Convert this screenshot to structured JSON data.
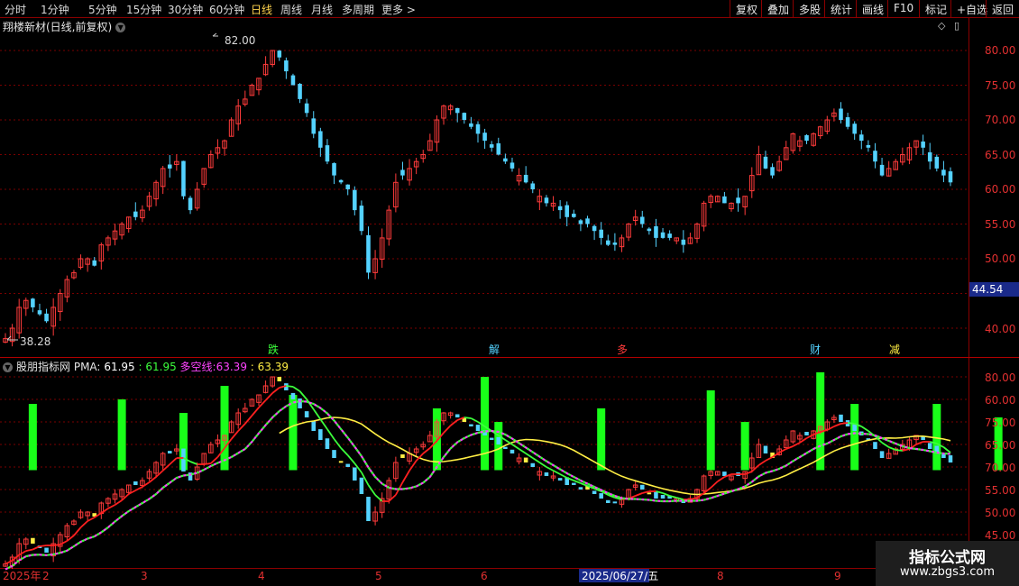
{
  "toolbar": {
    "periods": [
      "分时",
      "1分钟",
      "5分钟",
      "15分钟",
      "30分钟",
      "60分钟",
      "日线",
      "周线",
      "月线",
      "多周期",
      "更多 >"
    ],
    "active_period": "日线",
    "right_buttons": [
      "复权",
      "叠加",
      "多股",
      "统计",
      "画线",
      "F10",
      "标记",
      "+自选",
      "返回"
    ]
  },
  "stock": {
    "title": "翔楼新材(日线,前复权)",
    "high_mark": "82.00",
    "low_mark": "38.28",
    "price_tag": "44.54"
  },
  "price_axis": [
    "80.00",
    "75.00",
    "70.00",
    "65.00",
    "60.00",
    "55.00",
    "50.00",
    "40.00"
  ],
  "indicator_axis": [
    "80.00",
    "75.00",
    "70.00",
    "65.00",
    "60.00",
    "55.00",
    "50.00",
    "45.00"
  ],
  "signals": [
    "跌",
    "解",
    "多",
    "财",
    "减"
  ],
  "indicator": {
    "name": "股朋指标网",
    "pma_label": "PMA:",
    "pma_value": "61.95",
    "value2": ": 61.95",
    "dkx_label": "多空线:",
    "dkx_value": "63.39",
    "value4": ": 63.39"
  },
  "date_axis": [
    "2025年",
    "2",
    "3",
    "4",
    "5",
    "6",
    "2025/06/27/五",
    "8",
    "9"
  ],
  "watermark": {
    "line1": "指标公式网",
    "line2": "www.zbgs3.com"
  },
  "colors": {
    "up": "#ff3b3b",
    "down": "#54d2ff",
    "pma_line": "#ff2020",
    "trend_line": "#3cff3c",
    "yellow_line": "#ffee44",
    "dkx_line": "#ff44ff",
    "green_bars": "#19ff19",
    "grid": "#7a0000",
    "axis_text": "#e23030"
  },
  "chart_data": {
    "type": "candlestick",
    "x_range": [
      "2025-01-02",
      "2025-09-30"
    ],
    "y_range": [
      37,
      83
    ],
    "closes_estimated": [
      38.5,
      40,
      43,
      44,
      43,
      42,
      41,
      43,
      45,
      47,
      48,
      50,
      50,
      49,
      52,
      53,
      54,
      55,
      56,
      56,
      57,
      59,
      61,
      63,
      63,
      64,
      59,
      57,
      60,
      63,
      65,
      66,
      67,
      70,
      72,
      73,
      75,
      76,
      78,
      80,
      79,
      77,
      75,
      73,
      71,
      68,
      66,
      64,
      62,
      61,
      60,
      57,
      54,
      48,
      50,
      53,
      57,
      61,
      62,
      63,
      64,
      65,
      67,
      70,
      72,
      72,
      71,
      70,
      69,
      68,
      67,
      66,
      65,
      64,
      63,
      62,
      61,
      60,
      59,
      58,
      58,
      57,
      56,
      56,
      55,
      55,
      54,
      53,
      52,
      52,
      53,
      55,
      56,
      55,
      54,
      53,
      53,
      53,
      53,
      52,
      53,
      55,
      58,
      59,
      59,
      58,
      58,
      58,
      59,
      62,
      65,
      63,
      62,
      64,
      66,
      68,
      67,
      67,
      68,
      69,
      70,
      71,
      70,
      69,
      68,
      67,
      66,
      64,
      62,
      63,
      64,
      65,
      66,
      67,
      66,
      64,
      63,
      62,
      61
    ]
  }
}
